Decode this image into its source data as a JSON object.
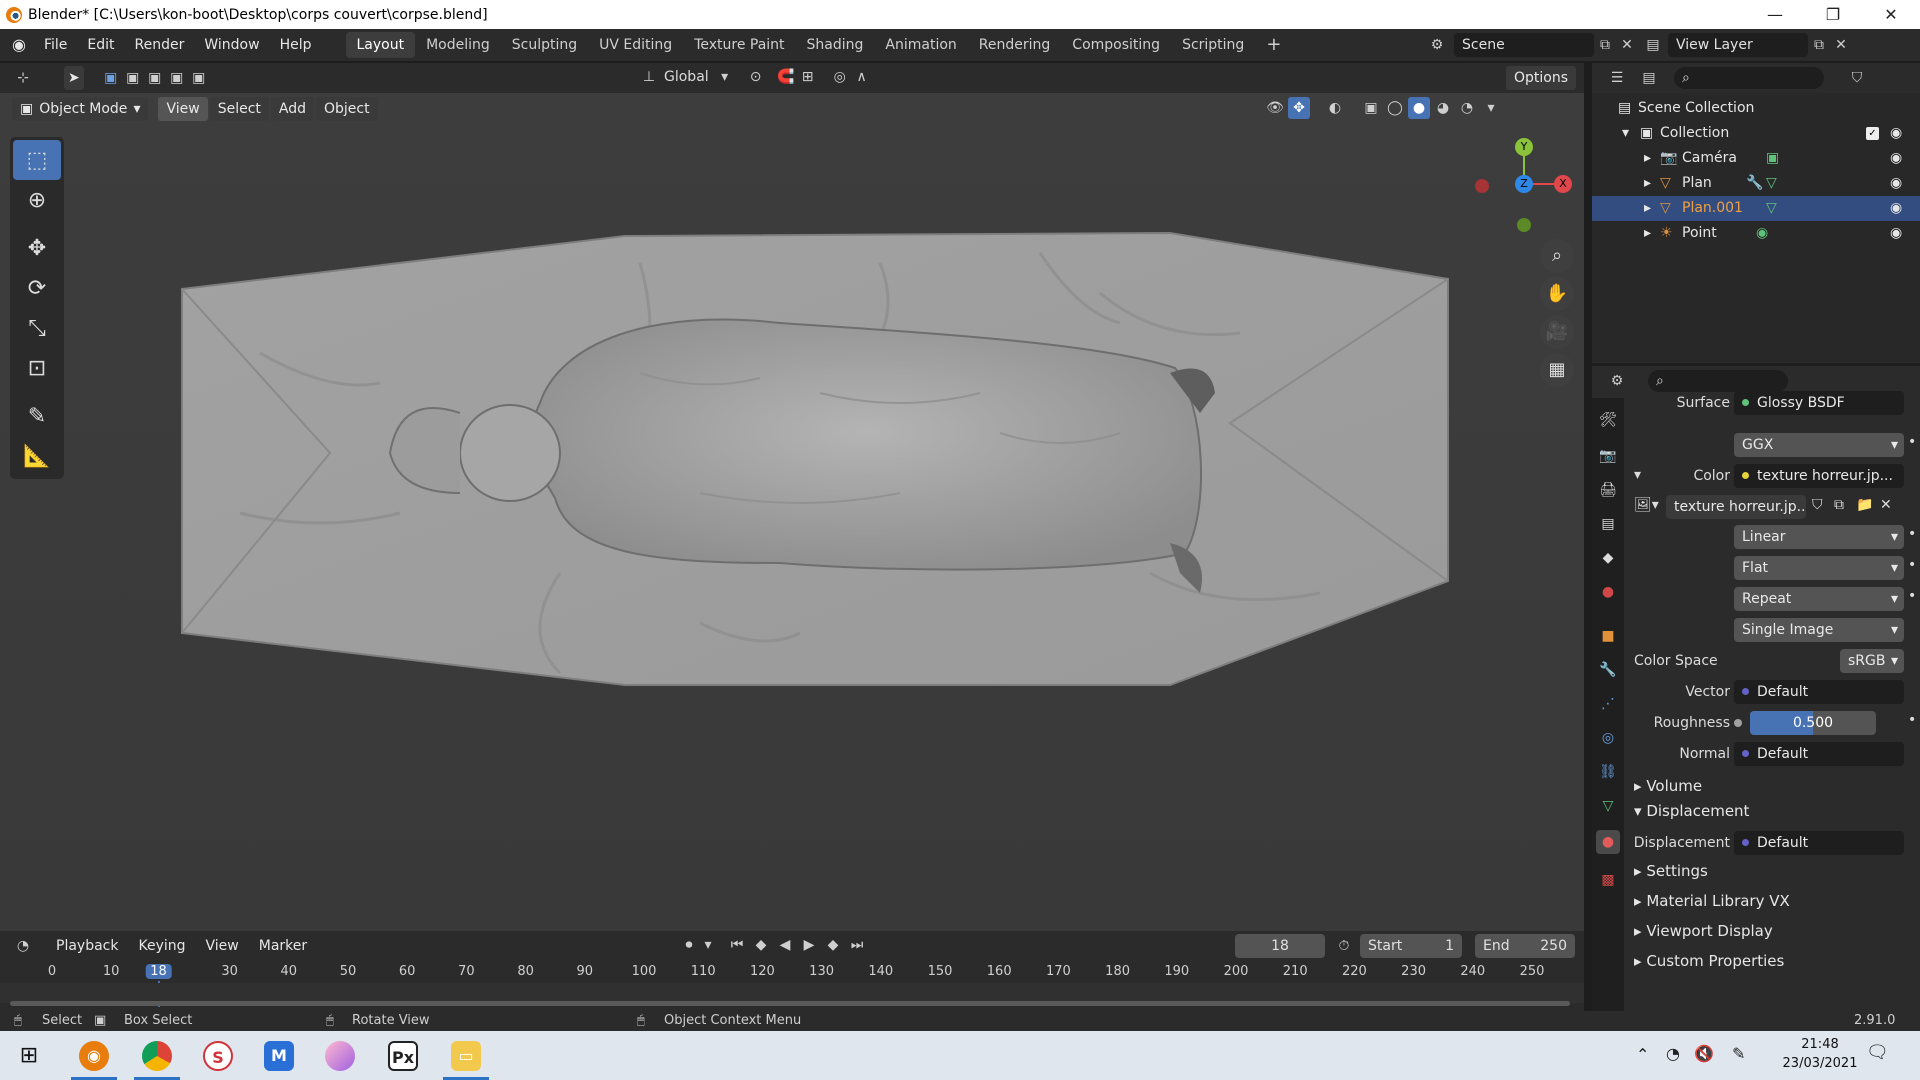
{
  "window": {
    "title": "Blender* [C:\\Users\\kon-boot\\Desktop\\corps couvert\\corpse.blend]",
    "minimize": "—",
    "maximize": "❐",
    "close": "✕"
  },
  "menu": [
    "File",
    "Edit",
    "Render",
    "Window",
    "Help"
  ],
  "workspaces": [
    {
      "label": "Layout",
      "active": true
    },
    {
      "label": "Modeling"
    },
    {
      "label": "Sculpting"
    },
    {
      "label": "UV Editing"
    },
    {
      "label": "Texture Paint"
    },
    {
      "label": "Shading"
    },
    {
      "label": "Animation"
    },
    {
      "label": "Rendering"
    },
    {
      "label": "Compositing"
    },
    {
      "label": "Scripting"
    }
  ],
  "add_workspace": "+",
  "scene": {
    "label": "Scene",
    "view_layer": "View Layer"
  },
  "header": {
    "transform": "Global",
    "options": "Options"
  },
  "viewport": {
    "mode": "Object Mode",
    "view": "View",
    "select": "Select",
    "add": "Add",
    "object": "Object",
    "gizmo": {
      "y": "Y",
      "z": "Z",
      "x": "X"
    }
  },
  "outliner": {
    "root": "Scene Collection",
    "collection": "Collection",
    "items": [
      {
        "name": "Caméra",
        "icon": "camera-icon"
      },
      {
        "name": "Plan",
        "icon": "mesh-icon"
      },
      {
        "name": "Plan.001",
        "icon": "mesh-icon",
        "selected": true
      },
      {
        "name": "Point",
        "icon": "light-icon"
      }
    ]
  },
  "properties": {
    "surface_label": "Surface",
    "surface_value": "Glossy BSDF",
    "distribution": "GGX",
    "color_label": "Color",
    "color_value": "texture horreur.jp...",
    "image_name": "texture horreur.jp...",
    "interpolation": "Linear",
    "projection": "Flat",
    "extension": "Repeat",
    "source": "Single Image",
    "color_space_label": "Color Space",
    "color_space": "sRGB",
    "vector_label": "Vector",
    "vector_value": "Default",
    "roughness_label": "Roughness",
    "roughness_value": "0.500",
    "roughness": 0.5,
    "normal_label": "Normal",
    "normal_value": "Default",
    "volume": "Volume",
    "displacement_section": "Displacement",
    "displacement_label": "Displacement",
    "displacement_value": "Default",
    "settings": "Settings",
    "material_library": "Material Library VX",
    "viewport_display": "Viewport Display",
    "custom_props": "Custom Properties"
  },
  "timeline": {
    "playback": "Playback",
    "keying": "Keying",
    "view": "View",
    "marker": "Marker",
    "current_frame": "18",
    "start_label": "Start",
    "start": "1",
    "end_label": "End",
    "end": "250",
    "ticks": [
      "0",
      "10",
      "18",
      "30",
      "40",
      "50",
      "60",
      "70",
      "80",
      "90",
      "100",
      "110",
      "120",
      "130",
      "140",
      "150",
      "160",
      "170",
      "180",
      "190",
      "200",
      "210",
      "220",
      "230",
      "240",
      "250"
    ]
  },
  "status": {
    "select": "Select",
    "box_select": "Box Select",
    "rotate": "Rotate View",
    "context": "Object Context Menu",
    "version": "2.91.0"
  },
  "taskbar": {
    "time": "21:48",
    "date": "23/03/2021"
  },
  "colors": {
    "accent": "#4772b3",
    "selected_row": "#334d80",
    "orange": "#e0913a",
    "axis_x": "#e0474a",
    "axis_y": "#8ac23a",
    "axis_z": "#2f88e6"
  }
}
